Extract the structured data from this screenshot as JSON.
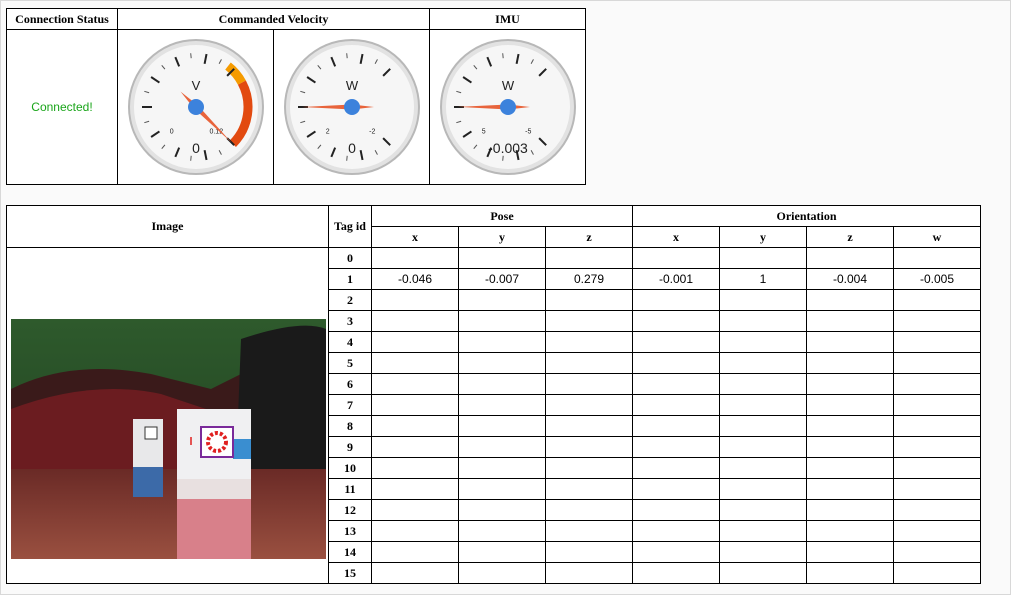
{
  "top": {
    "headers": {
      "connection": "Connection Status",
      "velocity": "Commanded Velocity",
      "imu": "IMU"
    },
    "status": {
      "text": "Connected!",
      "color": "#1aa51a"
    },
    "gauges": [
      {
        "label": "V",
        "value_text": "0",
        "min_label": "0",
        "max_label": "0.12",
        "value": 0,
        "min": 0,
        "max": 0.12,
        "has_red_zone": true
      },
      {
        "label": "W",
        "value_text": "0",
        "min_label": "2",
        "max_label": "-2",
        "value": 0,
        "min": 2,
        "max": -2,
        "has_red_zone": false
      },
      {
        "label": "W",
        "value_text": "-0.003",
        "min_label": "5",
        "max_label": "-5",
        "value": -0.003,
        "min": 5,
        "max": -5,
        "has_red_zone": false
      }
    ]
  },
  "table": {
    "image_header": "Image",
    "tag_header": "Tag id",
    "pose_header": "Pose",
    "orientation_header": "Orientation",
    "pose_cols": [
      "x",
      "y",
      "z"
    ],
    "orient_cols": [
      "x",
      "y",
      "z",
      "w"
    ],
    "rows": [
      {
        "tag": "0",
        "cells": [
          "",
          "",
          "",
          "",
          "",
          "",
          ""
        ]
      },
      {
        "tag": "1",
        "cells": [
          "-0.046",
          "-0.007",
          "0.279",
          "-0.001",
          "1",
          "-0.004",
          "-0.005"
        ]
      },
      {
        "tag": "2",
        "cells": [
          "",
          "",
          "",
          "",
          "",
          "",
          ""
        ]
      },
      {
        "tag": "3",
        "cells": [
          "",
          "",
          "",
          "",
          "",
          "",
          ""
        ]
      },
      {
        "tag": "4",
        "cells": [
          "",
          "",
          "",
          "",
          "",
          "",
          ""
        ]
      },
      {
        "tag": "5",
        "cells": [
          "",
          "",
          "",
          "",
          "",
          "",
          ""
        ]
      },
      {
        "tag": "6",
        "cells": [
          "",
          "",
          "",
          "",
          "",
          "",
          ""
        ]
      },
      {
        "tag": "7",
        "cells": [
          "",
          "",
          "",
          "",
          "",
          "",
          ""
        ]
      },
      {
        "tag": "8",
        "cells": [
          "",
          "",
          "",
          "",
          "",
          "",
          ""
        ]
      },
      {
        "tag": "9",
        "cells": [
          "",
          "",
          "",
          "",
          "",
          "",
          ""
        ]
      },
      {
        "tag": "10",
        "cells": [
          "",
          "",
          "",
          "",
          "",
          "",
          ""
        ]
      },
      {
        "tag": "11",
        "cells": [
          "",
          "",
          "",
          "",
          "",
          "",
          ""
        ]
      },
      {
        "tag": "12",
        "cells": [
          "",
          "",
          "",
          "",
          "",
          "",
          ""
        ]
      },
      {
        "tag": "13",
        "cells": [
          "",
          "",
          "",
          "",
          "",
          "",
          ""
        ]
      },
      {
        "tag": "14",
        "cells": [
          "",
          "",
          "",
          "",
          "",
          "",
          ""
        ]
      },
      {
        "tag": "15",
        "cells": [
          "",
          "",
          "",
          "",
          "",
          "",
          ""
        ]
      }
    ]
  },
  "colors": {
    "needle": "#e8643c",
    "hub": "#3c82dc",
    "orange_zone": "#f59b00",
    "red_zone": "#e24a10"
  }
}
